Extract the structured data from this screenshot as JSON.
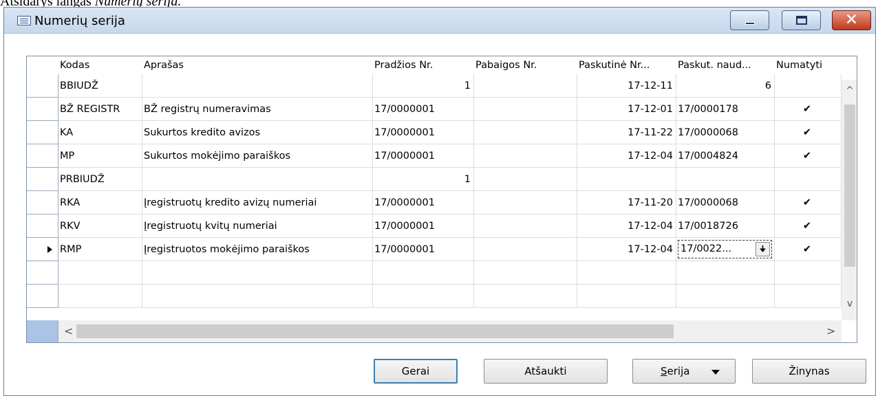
{
  "doc_caption": {
    "prefix": "Atsidarys langas ",
    "italic": "Numerių serija."
  },
  "window": {
    "title": "Numerių serija"
  },
  "icons": {
    "app": "list-window-icon",
    "minimize": "minimize-icon",
    "maximize": "maximize-icon",
    "close": "close-icon",
    "row_pointer": "row-pointer-icon",
    "checkmark": "checkmark-icon",
    "lookup": "lookup-arrow-icon",
    "dropdown": "chevron-down-icon"
  },
  "window_buttons": {
    "close_glyph": "✕"
  },
  "grid": {
    "headers": [
      "Kodas",
      "Aprašas",
      "Pradžios Nr.",
      "Pabaigos Nr.",
      "Paskutinė Nr...",
      "Paskut. naud...",
      "Numatyti"
    ],
    "rows": [
      {
        "kodas": "BBIUDŽ",
        "aprasas": "",
        "pradzios": "1",
        "pabaigos": "",
        "paskutine_data": "17-12-11",
        "paskut_naud": "6",
        "numatyti": ""
      },
      {
        "kodas": "BŽ REGISTR",
        "aprasas": "BŽ registrų numeravimas",
        "pradzios": "17/0000001",
        "pabaigos": "",
        "paskutine_data": "17-12-01",
        "paskut_naud": "17/0000178",
        "numatyti": "✔"
      },
      {
        "kodas": "KA",
        "aprasas": "Sukurtos kredito avizos",
        "pradzios": "17/0000001",
        "pabaigos": "",
        "paskutine_data": "17-11-22",
        "paskut_naud": "17/0000068",
        "numatyti": "✔"
      },
      {
        "kodas": "MP",
        "aprasas": "Sukurtos mokėjimo paraiškos",
        "pradzios": "17/0000001",
        "pabaigos": "",
        "paskutine_data": "17-12-04",
        "paskut_naud": "17/0004824",
        "numatyti": "✔"
      },
      {
        "kodas": "PRBIUDŽ",
        "aprasas": "",
        "pradzios": "1",
        "pabaigos": "",
        "paskutine_data": "",
        "paskut_naud": "",
        "numatyti": ""
      },
      {
        "kodas": "RKA",
        "aprasas": "Įregistruotų kredito avizų numeriai",
        "pradzios": "17/0000001",
        "pabaigos": "",
        "paskutine_data": "17-11-20",
        "paskut_naud": "17/0000068",
        "numatyti": "✔"
      },
      {
        "kodas": "RKV",
        "aprasas": "Įregistruotų kvitų numeriai",
        "pradzios": "17/0000001",
        "pabaigos": "",
        "paskutine_data": "17-12-04",
        "paskut_naud": "17/0018726",
        "numatyti": "✔"
      },
      {
        "kodas": "RMP",
        "aprasas": "Įregistruotos mokėjimo paraiškos",
        "pradzios": "17/0000001",
        "pabaigos": "",
        "paskutine_data": "17-12-04",
        "paskut_naud": "17/0022...",
        "numatyti": "✔"
      }
    ],
    "selected_row_kodas": "RMP",
    "edit_lookup_glyph": "🠋"
  },
  "scroll": {
    "up": "^",
    "down": "v",
    "left": "<",
    "right": ">"
  },
  "buttons": {
    "ok": "Gerai",
    "cancel": "Atšaukti",
    "series_mnemonic": "S",
    "series_rest": "erija",
    "help": "Žinynas"
  }
}
